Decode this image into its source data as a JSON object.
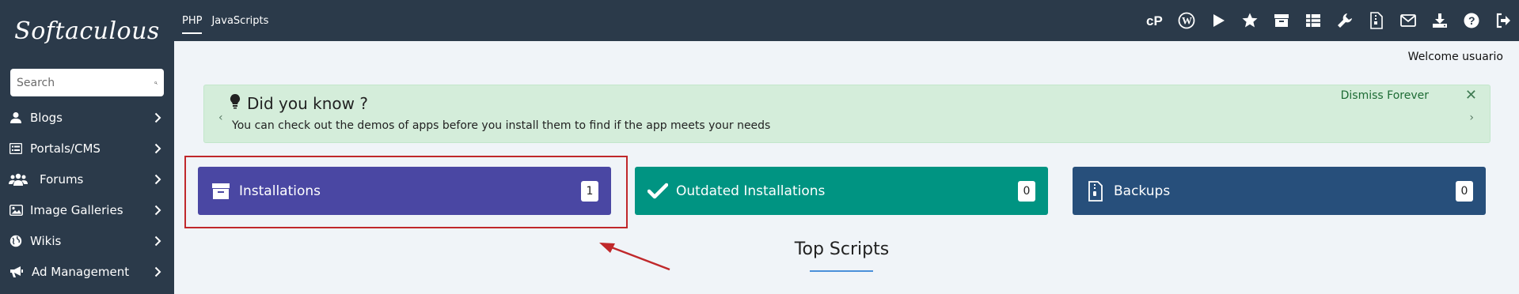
{
  "brand": {
    "logo_text": "Softaculous"
  },
  "search": {
    "placeholder": "Search"
  },
  "sidebar": {
    "items": [
      {
        "label": "Blogs",
        "icon": "user-icon"
      },
      {
        "label": "Portals/CMS",
        "icon": "list-icon"
      },
      {
        "label": "Forums",
        "icon": "users-icon"
      },
      {
        "label": "Image Galleries",
        "icon": "image-icon"
      },
      {
        "label": "Wikis",
        "icon": "globe-icon"
      },
      {
        "label": "Ad Management",
        "icon": "bullhorn-icon"
      }
    ]
  },
  "topbar": {
    "tabs": [
      {
        "label": "PHP",
        "active": true
      },
      {
        "label": "JavaScripts",
        "active": false
      }
    ],
    "icons": [
      "cpanel-icon",
      "wordpress-icon",
      "play-icon",
      "star-icon",
      "archive-icon",
      "table-icon",
      "wrench-icon",
      "file-zip-icon",
      "envelope-icon",
      "download-icon",
      "help-icon",
      "logout-icon"
    ]
  },
  "welcome": "Welcome usuario",
  "did_you_know": {
    "title": "Did you know ?",
    "text": "You can check out the demos of apps before you install them to find if the app meets your needs",
    "dismiss": "Dismiss Forever",
    "close": "✕",
    "prev": "‹",
    "next": "›"
  },
  "cards": {
    "installations": {
      "label": "Installations",
      "count": "1",
      "color": "#4a47a3"
    },
    "outdated": {
      "label": "Outdated Installations",
      "count": "0",
      "color": "#009482"
    },
    "backups": {
      "label": "Backups",
      "count": "0",
      "color": "#274f7b"
    }
  },
  "top_scripts": {
    "title": "Top Scripts"
  },
  "colors": {
    "sidebar_bg": "#2b3a4a",
    "highlight": "#c0282b",
    "dyk_bg": "#d4edda"
  }
}
